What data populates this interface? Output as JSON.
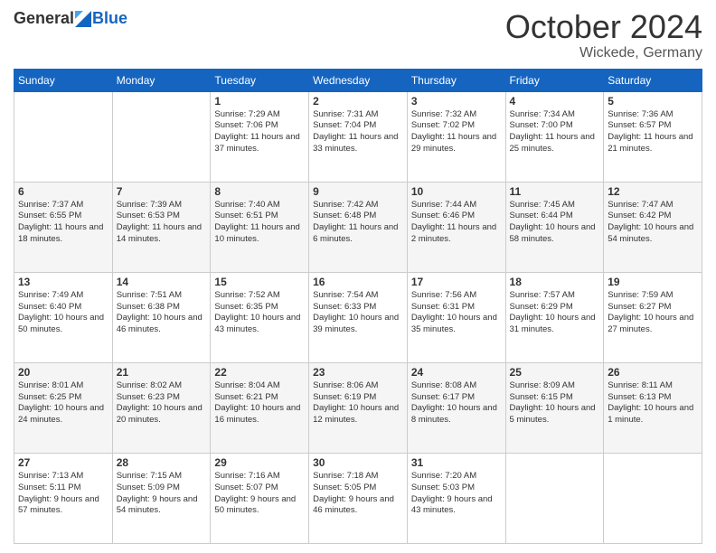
{
  "header": {
    "logo": {
      "general": "General",
      "blue": "Blue"
    },
    "title": "October 2024",
    "location": "Wickede, Germany"
  },
  "days_of_week": [
    "Sunday",
    "Monday",
    "Tuesday",
    "Wednesday",
    "Thursday",
    "Friday",
    "Saturday"
  ],
  "weeks": [
    [
      {
        "day": null,
        "sunrise": null,
        "sunset": null,
        "daylight": null
      },
      {
        "day": null,
        "sunrise": null,
        "sunset": null,
        "daylight": null
      },
      {
        "day": "1",
        "sunrise": "Sunrise: 7:29 AM",
        "sunset": "Sunset: 7:06 PM",
        "daylight": "Daylight: 11 hours and 37 minutes."
      },
      {
        "day": "2",
        "sunrise": "Sunrise: 7:31 AM",
        "sunset": "Sunset: 7:04 PM",
        "daylight": "Daylight: 11 hours and 33 minutes."
      },
      {
        "day": "3",
        "sunrise": "Sunrise: 7:32 AM",
        "sunset": "Sunset: 7:02 PM",
        "daylight": "Daylight: 11 hours and 29 minutes."
      },
      {
        "day": "4",
        "sunrise": "Sunrise: 7:34 AM",
        "sunset": "Sunset: 7:00 PM",
        "daylight": "Daylight: 11 hours and 25 minutes."
      },
      {
        "day": "5",
        "sunrise": "Sunrise: 7:36 AM",
        "sunset": "Sunset: 6:57 PM",
        "daylight": "Daylight: 11 hours and 21 minutes."
      }
    ],
    [
      {
        "day": "6",
        "sunrise": "Sunrise: 7:37 AM",
        "sunset": "Sunset: 6:55 PM",
        "daylight": "Daylight: 11 hours and 18 minutes."
      },
      {
        "day": "7",
        "sunrise": "Sunrise: 7:39 AM",
        "sunset": "Sunset: 6:53 PM",
        "daylight": "Daylight: 11 hours and 14 minutes."
      },
      {
        "day": "8",
        "sunrise": "Sunrise: 7:40 AM",
        "sunset": "Sunset: 6:51 PM",
        "daylight": "Daylight: 11 hours and 10 minutes."
      },
      {
        "day": "9",
        "sunrise": "Sunrise: 7:42 AM",
        "sunset": "Sunset: 6:48 PM",
        "daylight": "Daylight: 11 hours and 6 minutes."
      },
      {
        "day": "10",
        "sunrise": "Sunrise: 7:44 AM",
        "sunset": "Sunset: 6:46 PM",
        "daylight": "Daylight: 11 hours and 2 minutes."
      },
      {
        "day": "11",
        "sunrise": "Sunrise: 7:45 AM",
        "sunset": "Sunset: 6:44 PM",
        "daylight": "Daylight: 10 hours and 58 minutes."
      },
      {
        "day": "12",
        "sunrise": "Sunrise: 7:47 AM",
        "sunset": "Sunset: 6:42 PM",
        "daylight": "Daylight: 10 hours and 54 minutes."
      }
    ],
    [
      {
        "day": "13",
        "sunrise": "Sunrise: 7:49 AM",
        "sunset": "Sunset: 6:40 PM",
        "daylight": "Daylight: 10 hours and 50 minutes."
      },
      {
        "day": "14",
        "sunrise": "Sunrise: 7:51 AM",
        "sunset": "Sunset: 6:38 PM",
        "daylight": "Daylight: 10 hours and 46 minutes."
      },
      {
        "day": "15",
        "sunrise": "Sunrise: 7:52 AM",
        "sunset": "Sunset: 6:35 PM",
        "daylight": "Daylight: 10 hours and 43 minutes."
      },
      {
        "day": "16",
        "sunrise": "Sunrise: 7:54 AM",
        "sunset": "Sunset: 6:33 PM",
        "daylight": "Daylight: 10 hours and 39 minutes."
      },
      {
        "day": "17",
        "sunrise": "Sunrise: 7:56 AM",
        "sunset": "Sunset: 6:31 PM",
        "daylight": "Daylight: 10 hours and 35 minutes."
      },
      {
        "day": "18",
        "sunrise": "Sunrise: 7:57 AM",
        "sunset": "Sunset: 6:29 PM",
        "daylight": "Daylight: 10 hours and 31 minutes."
      },
      {
        "day": "19",
        "sunrise": "Sunrise: 7:59 AM",
        "sunset": "Sunset: 6:27 PM",
        "daylight": "Daylight: 10 hours and 27 minutes."
      }
    ],
    [
      {
        "day": "20",
        "sunrise": "Sunrise: 8:01 AM",
        "sunset": "Sunset: 6:25 PM",
        "daylight": "Daylight: 10 hours and 24 minutes."
      },
      {
        "day": "21",
        "sunrise": "Sunrise: 8:02 AM",
        "sunset": "Sunset: 6:23 PM",
        "daylight": "Daylight: 10 hours and 20 minutes."
      },
      {
        "day": "22",
        "sunrise": "Sunrise: 8:04 AM",
        "sunset": "Sunset: 6:21 PM",
        "daylight": "Daylight: 10 hours and 16 minutes."
      },
      {
        "day": "23",
        "sunrise": "Sunrise: 8:06 AM",
        "sunset": "Sunset: 6:19 PM",
        "daylight": "Daylight: 10 hours and 12 minutes."
      },
      {
        "day": "24",
        "sunrise": "Sunrise: 8:08 AM",
        "sunset": "Sunset: 6:17 PM",
        "daylight": "Daylight: 10 hours and 8 minutes."
      },
      {
        "day": "25",
        "sunrise": "Sunrise: 8:09 AM",
        "sunset": "Sunset: 6:15 PM",
        "daylight": "Daylight: 10 hours and 5 minutes."
      },
      {
        "day": "26",
        "sunrise": "Sunrise: 8:11 AM",
        "sunset": "Sunset: 6:13 PM",
        "daylight": "Daylight: 10 hours and 1 minute."
      }
    ],
    [
      {
        "day": "27",
        "sunrise": "Sunrise: 7:13 AM",
        "sunset": "Sunset: 5:11 PM",
        "daylight": "Daylight: 9 hours and 57 minutes."
      },
      {
        "day": "28",
        "sunrise": "Sunrise: 7:15 AM",
        "sunset": "Sunset: 5:09 PM",
        "daylight": "Daylight: 9 hours and 54 minutes."
      },
      {
        "day": "29",
        "sunrise": "Sunrise: 7:16 AM",
        "sunset": "Sunset: 5:07 PM",
        "daylight": "Daylight: 9 hours and 50 minutes."
      },
      {
        "day": "30",
        "sunrise": "Sunrise: 7:18 AM",
        "sunset": "Sunset: 5:05 PM",
        "daylight": "Daylight: 9 hours and 46 minutes."
      },
      {
        "day": "31",
        "sunrise": "Sunrise: 7:20 AM",
        "sunset": "Sunset: 5:03 PM",
        "daylight": "Daylight: 9 hours and 43 minutes."
      },
      {
        "day": null,
        "sunrise": null,
        "sunset": null,
        "daylight": null
      },
      {
        "day": null,
        "sunrise": null,
        "sunset": null,
        "daylight": null
      }
    ]
  ]
}
